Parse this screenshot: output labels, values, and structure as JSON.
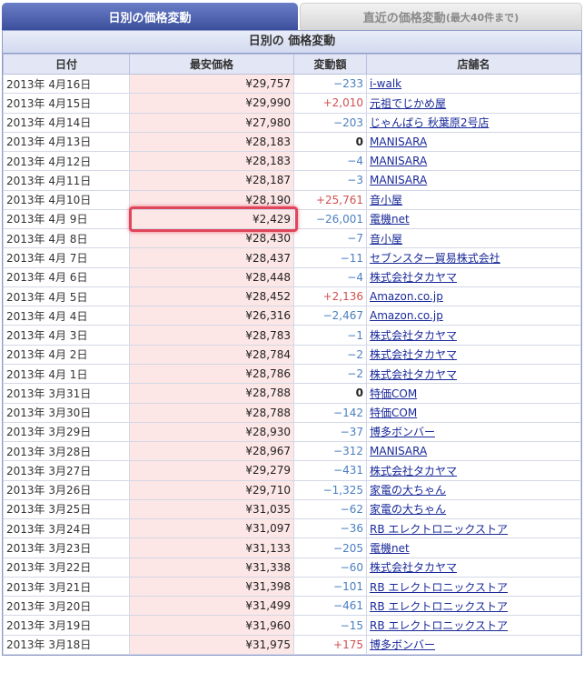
{
  "tabs": {
    "active": {
      "label": "日別の価格変動",
      "sub": ""
    },
    "inactive": {
      "label": "直近の価格変動",
      "sub": "(最大40件まで)"
    }
  },
  "section_title": "日別の 価格変動",
  "headers": {
    "date": "日付",
    "price": "最安価格",
    "change": "変動額",
    "store": "店舗名"
  },
  "rows": [
    {
      "date": "2013年 4月16日",
      "price": "¥29,757",
      "change": "−233",
      "dir": "neg",
      "store": "i-walk"
    },
    {
      "date": "2013年 4月15日",
      "price": "¥29,990",
      "change": "+2,010",
      "dir": "pos",
      "store": "元祖でじかめ屋"
    },
    {
      "date": "2013年 4月14日",
      "price": "¥27,980",
      "change": "−203",
      "dir": "neg",
      "store": "じゃんぱら 秋葉原2号店"
    },
    {
      "date": "2013年 4月13日",
      "price": "¥28,183",
      "change": "0",
      "dir": "zero",
      "store": "MANISARA"
    },
    {
      "date": "2013年 4月12日",
      "price": "¥28,183",
      "change": "−4",
      "dir": "neg",
      "store": "MANISARA"
    },
    {
      "date": "2013年 4月11日",
      "price": "¥28,187",
      "change": "−3",
      "dir": "neg",
      "store": "MANISARA"
    },
    {
      "date": "2013年 4月10日",
      "price": "¥28,190",
      "change": "+25,761",
      "dir": "pos",
      "store": "音小屋"
    },
    {
      "date": "2013年 4月 9日",
      "price": "¥2,429",
      "change": "−26,001",
      "dir": "neg",
      "store": "電機net"
    },
    {
      "date": "2013年 4月 8日",
      "price": "¥28,430",
      "change": "−7",
      "dir": "neg",
      "store": "音小屋"
    },
    {
      "date": "2013年 4月 7日",
      "price": "¥28,437",
      "change": "−11",
      "dir": "neg",
      "store": "セブンスター貿易株式会社"
    },
    {
      "date": "2013年 4月 6日",
      "price": "¥28,448",
      "change": "−4",
      "dir": "neg",
      "store": "株式会社タカヤマ"
    },
    {
      "date": "2013年 4月 5日",
      "price": "¥28,452",
      "change": "+2,136",
      "dir": "pos",
      "store": "Amazon.co.jp"
    },
    {
      "date": "2013年 4月 4日",
      "price": "¥26,316",
      "change": "−2,467",
      "dir": "neg",
      "store": "Amazon.co.jp"
    },
    {
      "date": "2013年 4月 3日",
      "price": "¥28,783",
      "change": "−1",
      "dir": "neg",
      "store": "株式会社タカヤマ"
    },
    {
      "date": "2013年 4月 2日",
      "price": "¥28,784",
      "change": "−2",
      "dir": "neg",
      "store": "株式会社タカヤマ"
    },
    {
      "date": "2013年 4月 1日",
      "price": "¥28,786",
      "change": "−2",
      "dir": "neg",
      "store": "株式会社タカヤマ"
    },
    {
      "date": "2013年 3月31日",
      "price": "¥28,788",
      "change": "0",
      "dir": "zero",
      "store": "特価COM"
    },
    {
      "date": "2013年 3月30日",
      "price": "¥28,788",
      "change": "−142",
      "dir": "neg",
      "store": "特価COM"
    },
    {
      "date": "2013年 3月29日",
      "price": "¥28,930",
      "change": "−37",
      "dir": "neg",
      "store": "博多ボンバー"
    },
    {
      "date": "2013年 3月28日",
      "price": "¥28,967",
      "change": "−312",
      "dir": "neg",
      "store": "MANISARA"
    },
    {
      "date": "2013年 3月27日",
      "price": "¥29,279",
      "change": "−431",
      "dir": "neg",
      "store": "株式会社タカヤマ"
    },
    {
      "date": "2013年 3月26日",
      "price": "¥29,710",
      "change": "−1,325",
      "dir": "neg",
      "store": "家電の大ちゃん"
    },
    {
      "date": "2013年 3月25日",
      "price": "¥31,035",
      "change": "−62",
      "dir": "neg",
      "store": "家電の大ちゃん"
    },
    {
      "date": "2013年 3月24日",
      "price": "¥31,097",
      "change": "−36",
      "dir": "neg",
      "store": "RB エレクトロニックストア"
    },
    {
      "date": "2013年 3月23日",
      "price": "¥31,133",
      "change": "−205",
      "dir": "neg",
      "store": "電機net"
    },
    {
      "date": "2013年 3月22日",
      "price": "¥31,338",
      "change": "−60",
      "dir": "neg",
      "store": "株式会社タカヤマ"
    },
    {
      "date": "2013年 3月21日",
      "price": "¥31,398",
      "change": "−101",
      "dir": "neg",
      "store": "RB エレクトロニックストア"
    },
    {
      "date": "2013年 3月20日",
      "price": "¥31,499",
      "change": "−461",
      "dir": "neg",
      "store": "RB エレクトロニックストア"
    },
    {
      "date": "2013年 3月19日",
      "price": "¥31,960",
      "change": "−15",
      "dir": "neg",
      "store": "RB エレクトロニックストア"
    },
    {
      "date": "2013年 3月18日",
      "price": "¥31,975",
      "change": "+175",
      "dir": "pos",
      "store": "博多ボンバー"
    }
  ],
  "highlighted_row": 7
}
